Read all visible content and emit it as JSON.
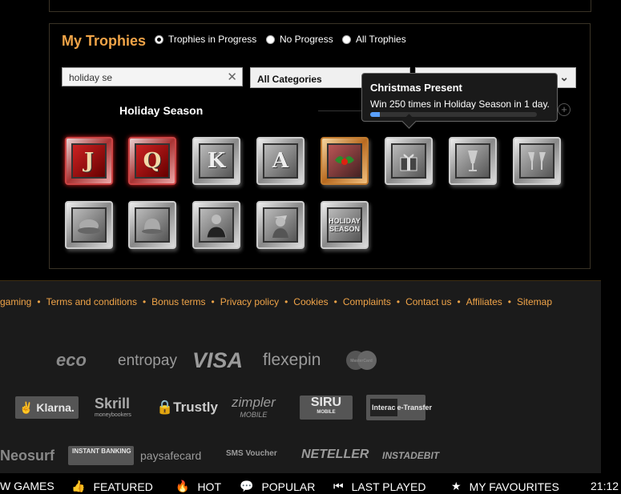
{
  "panel": {
    "title": "My Trophies",
    "filters": [
      {
        "label": "Trophies in Progress",
        "checked": true
      },
      {
        "label": "No Progress",
        "checked": false
      },
      {
        "label": "All Trophies",
        "checked": false
      }
    ],
    "search": {
      "value": "holiday se",
      "clear_icon": "clear-icon"
    },
    "category_select": {
      "value": "All Categories"
    },
    "second_select": {
      "value": ""
    },
    "group_title": "Holiday Season",
    "tiles": [
      {
        "name": "J",
        "style": "red"
      },
      {
        "name": "Q",
        "style": "red"
      },
      {
        "name": "K",
        "style": "silver"
      },
      {
        "name": "A",
        "style": "silver"
      },
      {
        "name": "holly",
        "style": "gold",
        "icon": "holly-icon"
      },
      {
        "name": "present",
        "style": "silver",
        "icon": "gift-icon"
      },
      {
        "name": "champagne",
        "style": "silver",
        "icon": "champagne-icon"
      },
      {
        "name": "cheers",
        "style": "silver",
        "icon": "cheers-icon"
      },
      {
        "name": "turkey",
        "style": "silver",
        "icon": "turkey-icon"
      },
      {
        "name": "pudding",
        "style": "silver",
        "icon": "pudding-icon"
      },
      {
        "name": "man",
        "style": "silver",
        "icon": "man-icon"
      },
      {
        "name": "woman",
        "style": "silver",
        "icon": "woman-icon"
      },
      {
        "name": "holiday-season",
        "style": "silver",
        "text": "HOLIDAY SEASON"
      }
    ],
    "tooltip": {
      "title": "Christmas Present",
      "description": "Win 250 times in Holiday Season in 1 day.",
      "progress": 0.06
    }
  },
  "footer": {
    "links": [
      "gaming",
      "Terms and conditions",
      "Bonus terms",
      "Privacy policy",
      "Cookies",
      "Complaints",
      "Contact us",
      "Affiliates",
      "Sitemap"
    ],
    "payments_row1": [
      "eco",
      "entropay",
      "VISA",
      "flexepin",
      "MasterCard"
    ],
    "payments_row2": [
      "Klarna.",
      "Skrill",
      "Trustly",
      "zimpler",
      "SIRU",
      "e-Transfer"
    ],
    "payments_row3": [
      "Neosurf",
      "INSTANT BANKING",
      "paysafecard",
      "SMS Voucher",
      "NETELLER",
      "INSTADEBIT"
    ],
    "payment_sublabels": {
      "skrill": "moneybookers",
      "zimpler": "MOBILE",
      "siru": "MOBILE",
      "interac": "Interac"
    }
  },
  "navbar": {
    "items": [
      {
        "label": "W GAMES",
        "icon": ""
      },
      {
        "label": "FEATURED",
        "icon": "thumbs-up-icon"
      },
      {
        "label": "HOT",
        "icon": "flame-icon"
      },
      {
        "label": "POPULAR",
        "icon": "chat-icon"
      },
      {
        "label": "LAST PLAYED",
        "icon": "rewind-icon"
      },
      {
        "label": "MY FAVOURITES",
        "icon": "star-icon"
      }
    ],
    "time": "21:12"
  },
  "colors": {
    "accent": "#f0a448",
    "background": "#000000",
    "footer": "#1b1b1b"
  }
}
